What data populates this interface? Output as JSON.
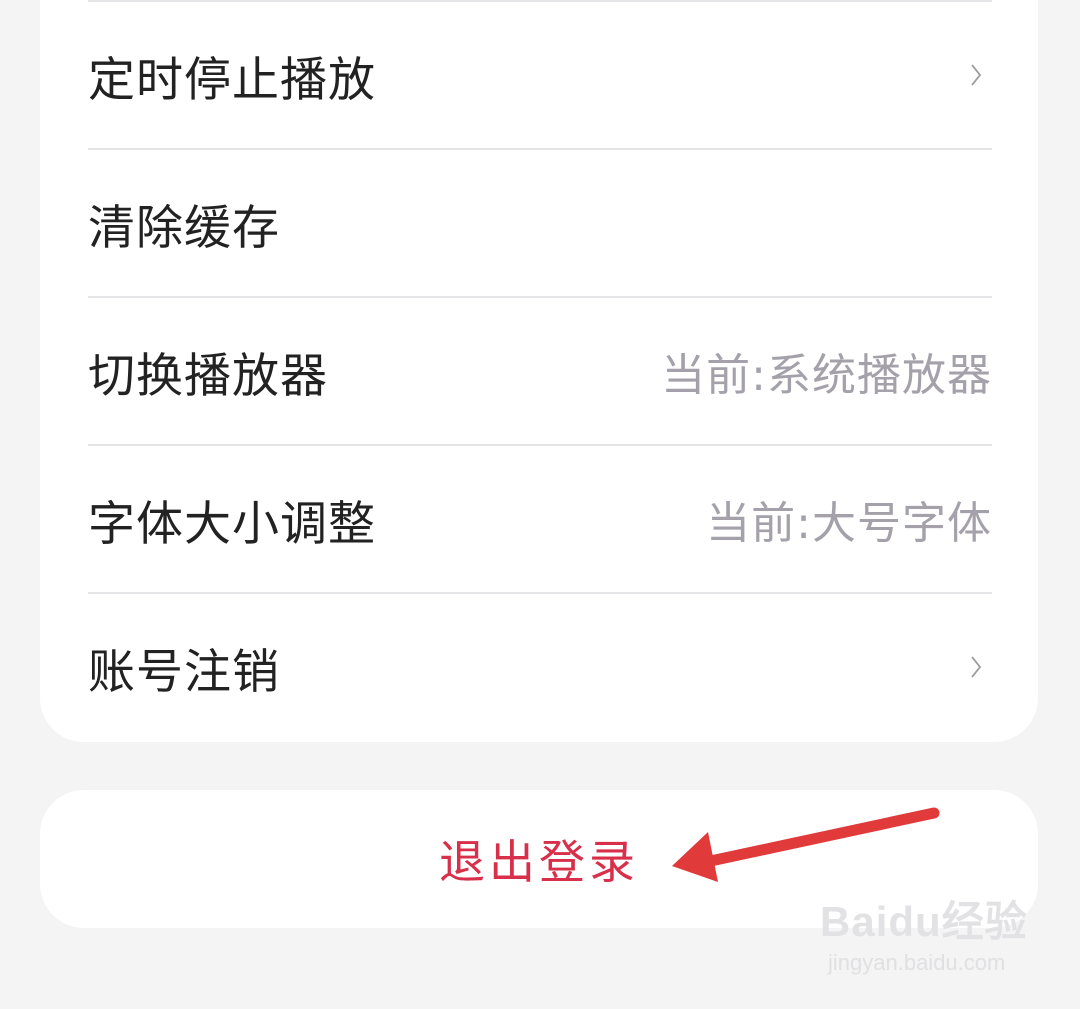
{
  "settings": {
    "items": [
      {
        "label": "定时停止播放",
        "value": "",
        "chevron": true
      },
      {
        "label": "清除缓存",
        "value": "",
        "chevron": false
      },
      {
        "label": "切换播放器",
        "value": "当前:系统播放器",
        "chevron": false
      },
      {
        "label": "字体大小调整",
        "value": "当前:大号字体",
        "chevron": false
      },
      {
        "label": "账号注销",
        "value": "",
        "chevron": true
      }
    ]
  },
  "logout": {
    "label": "退出登录"
  },
  "annotation": {
    "icon": "red-arrow-icon",
    "color": "#e03a3a"
  },
  "watermark": {
    "logo": "Baidu经验",
    "url": "jingyan.baidu.com"
  },
  "colors": {
    "accent": "#d8304a",
    "value_text": "#a4a1ab",
    "divider": "#e4e4e6"
  }
}
